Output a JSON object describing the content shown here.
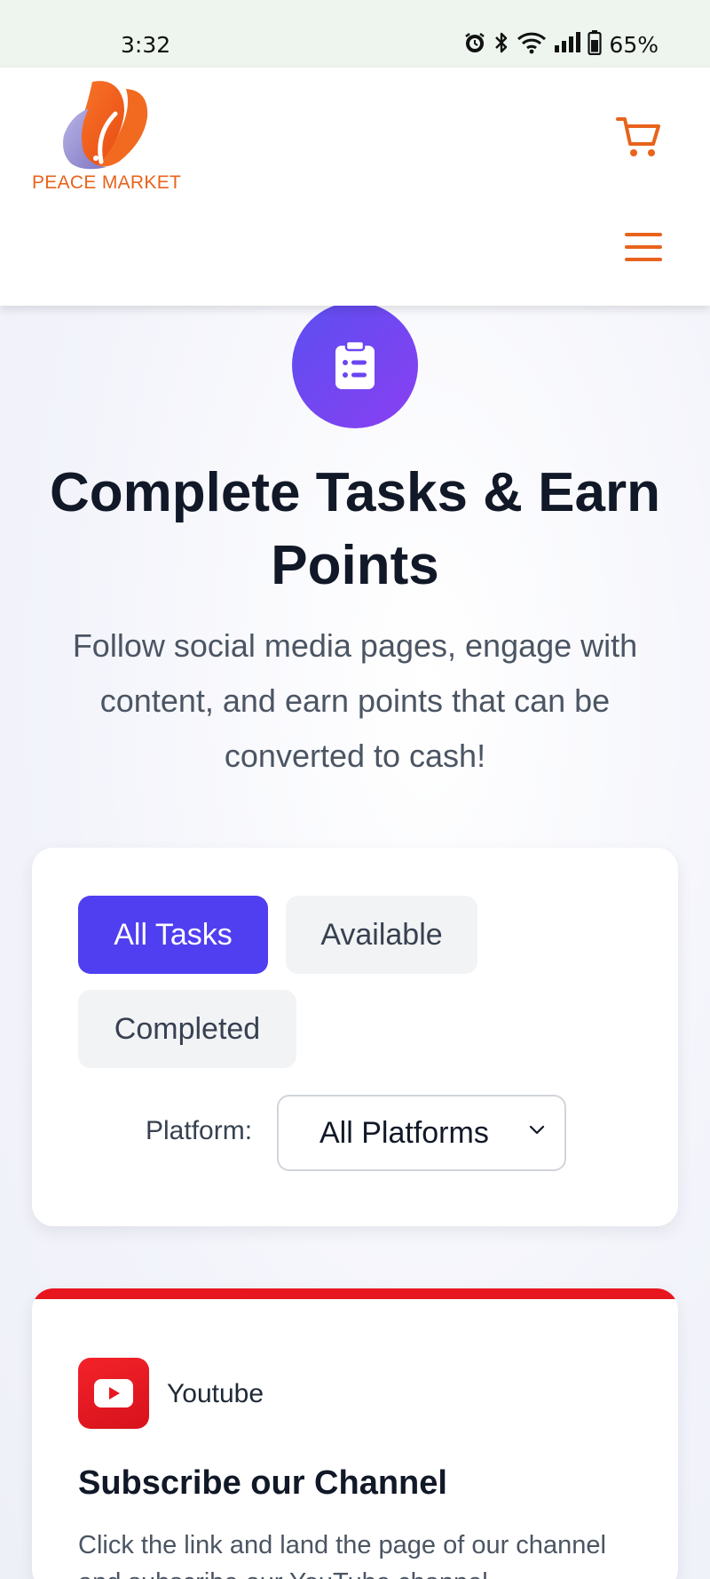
{
  "status_bar": {
    "time": "3:32",
    "battery": "65%",
    "icons": [
      "alarm-icon",
      "bluetooth-icon",
      "wifi-icon",
      "signal-icon",
      "battery-icon"
    ]
  },
  "header": {
    "logo_text": "PEACE MARKET",
    "cart_icon": "cart-icon",
    "menu_icon": "hamburger-menu-icon",
    "accent": "#e8631c"
  },
  "hero": {
    "icon": "clipboard-list-icon",
    "title": "Complete Tasks & Earn Points",
    "subtitle": "Follow social media pages, engage with content, and earn points that can be converted to cash!",
    "gradient": [
      "#5b4ff0",
      "#8a3ff2"
    ]
  },
  "filters": {
    "tabs": [
      {
        "label": "All Tasks",
        "active": true
      },
      {
        "label": "Available",
        "active": false
      },
      {
        "label": "Completed",
        "active": false
      }
    ],
    "platform_label": "Platform:",
    "platform_selected": "All Platforms",
    "active_color": "#4f3ff0"
  },
  "task": {
    "platform": "Youtube",
    "platform_icon": "youtube-icon",
    "title": "Subscribe our Channel",
    "description": "Click the link and land the page of our channel and subscribe our YouTube channel",
    "accent": "#e8161f"
  }
}
